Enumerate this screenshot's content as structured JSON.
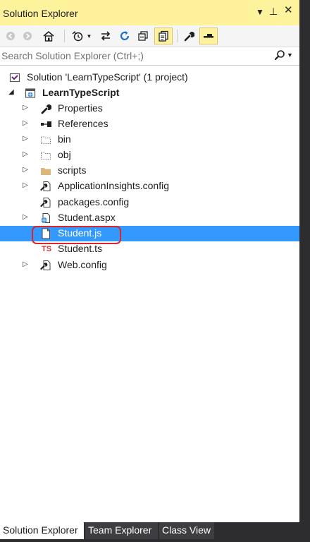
{
  "window": {
    "title": "Solution Explorer"
  },
  "toolbar": {
    "buttons": [
      "back-icon",
      "forward-icon",
      "home-icon",
      "history-icon",
      "sync-icon",
      "refresh-icon",
      "collapse-all-icon",
      "show-all-files-icon",
      "properties-icon",
      "preview-icon"
    ]
  },
  "search": {
    "placeholder": "Search Solution Explorer (Ctrl+;)"
  },
  "tree": [
    {
      "label": "Solution 'LearnTypeScript' (1 project)",
      "icon": "solution-icon",
      "expander": "none"
    },
    {
      "label": "LearnTypeScript",
      "icon": "web-project-icon",
      "expander": "expanded"
    },
    {
      "label": "Properties",
      "icon": "wrench-icon",
      "expander": "collapsed"
    },
    {
      "label": "References",
      "icon": "references-icon",
      "expander": "collapsed"
    },
    {
      "label": "bin",
      "icon": "folder-dotted-icon",
      "expander": "collapsed"
    },
    {
      "label": "obj",
      "icon": "folder-dotted-icon",
      "expander": "collapsed"
    },
    {
      "label": "scripts",
      "icon": "folder-icon",
      "expander": "collapsed"
    },
    {
      "label": "ApplicationInsights.config",
      "icon": "config-file-icon",
      "expander": "collapsed"
    },
    {
      "label": "packages.config",
      "icon": "config-file-icon",
      "expander": "none"
    },
    {
      "label": "Student.aspx",
      "icon": "web-file-icon",
      "expander": "collapsed"
    },
    {
      "label": "Student.js",
      "icon": "js-file-icon",
      "expander": "none",
      "selected": true
    },
    {
      "label": "Student.ts",
      "icon": "ts-file-icon",
      "expander": "none",
      "badge": "TS"
    },
    {
      "label": "Web.config",
      "icon": "config-file-icon",
      "expander": "collapsed"
    }
  ],
  "tabs": [
    {
      "label": "Solution Explorer",
      "active": true
    },
    {
      "label": "Team Explorer",
      "active": false
    },
    {
      "label": "Class View",
      "active": false
    }
  ],
  "colors": {
    "title_active": "#fff29d",
    "selection": "#3399ff",
    "highlight_ring": "#d9262b",
    "ts_badge": "#d13438"
  }
}
